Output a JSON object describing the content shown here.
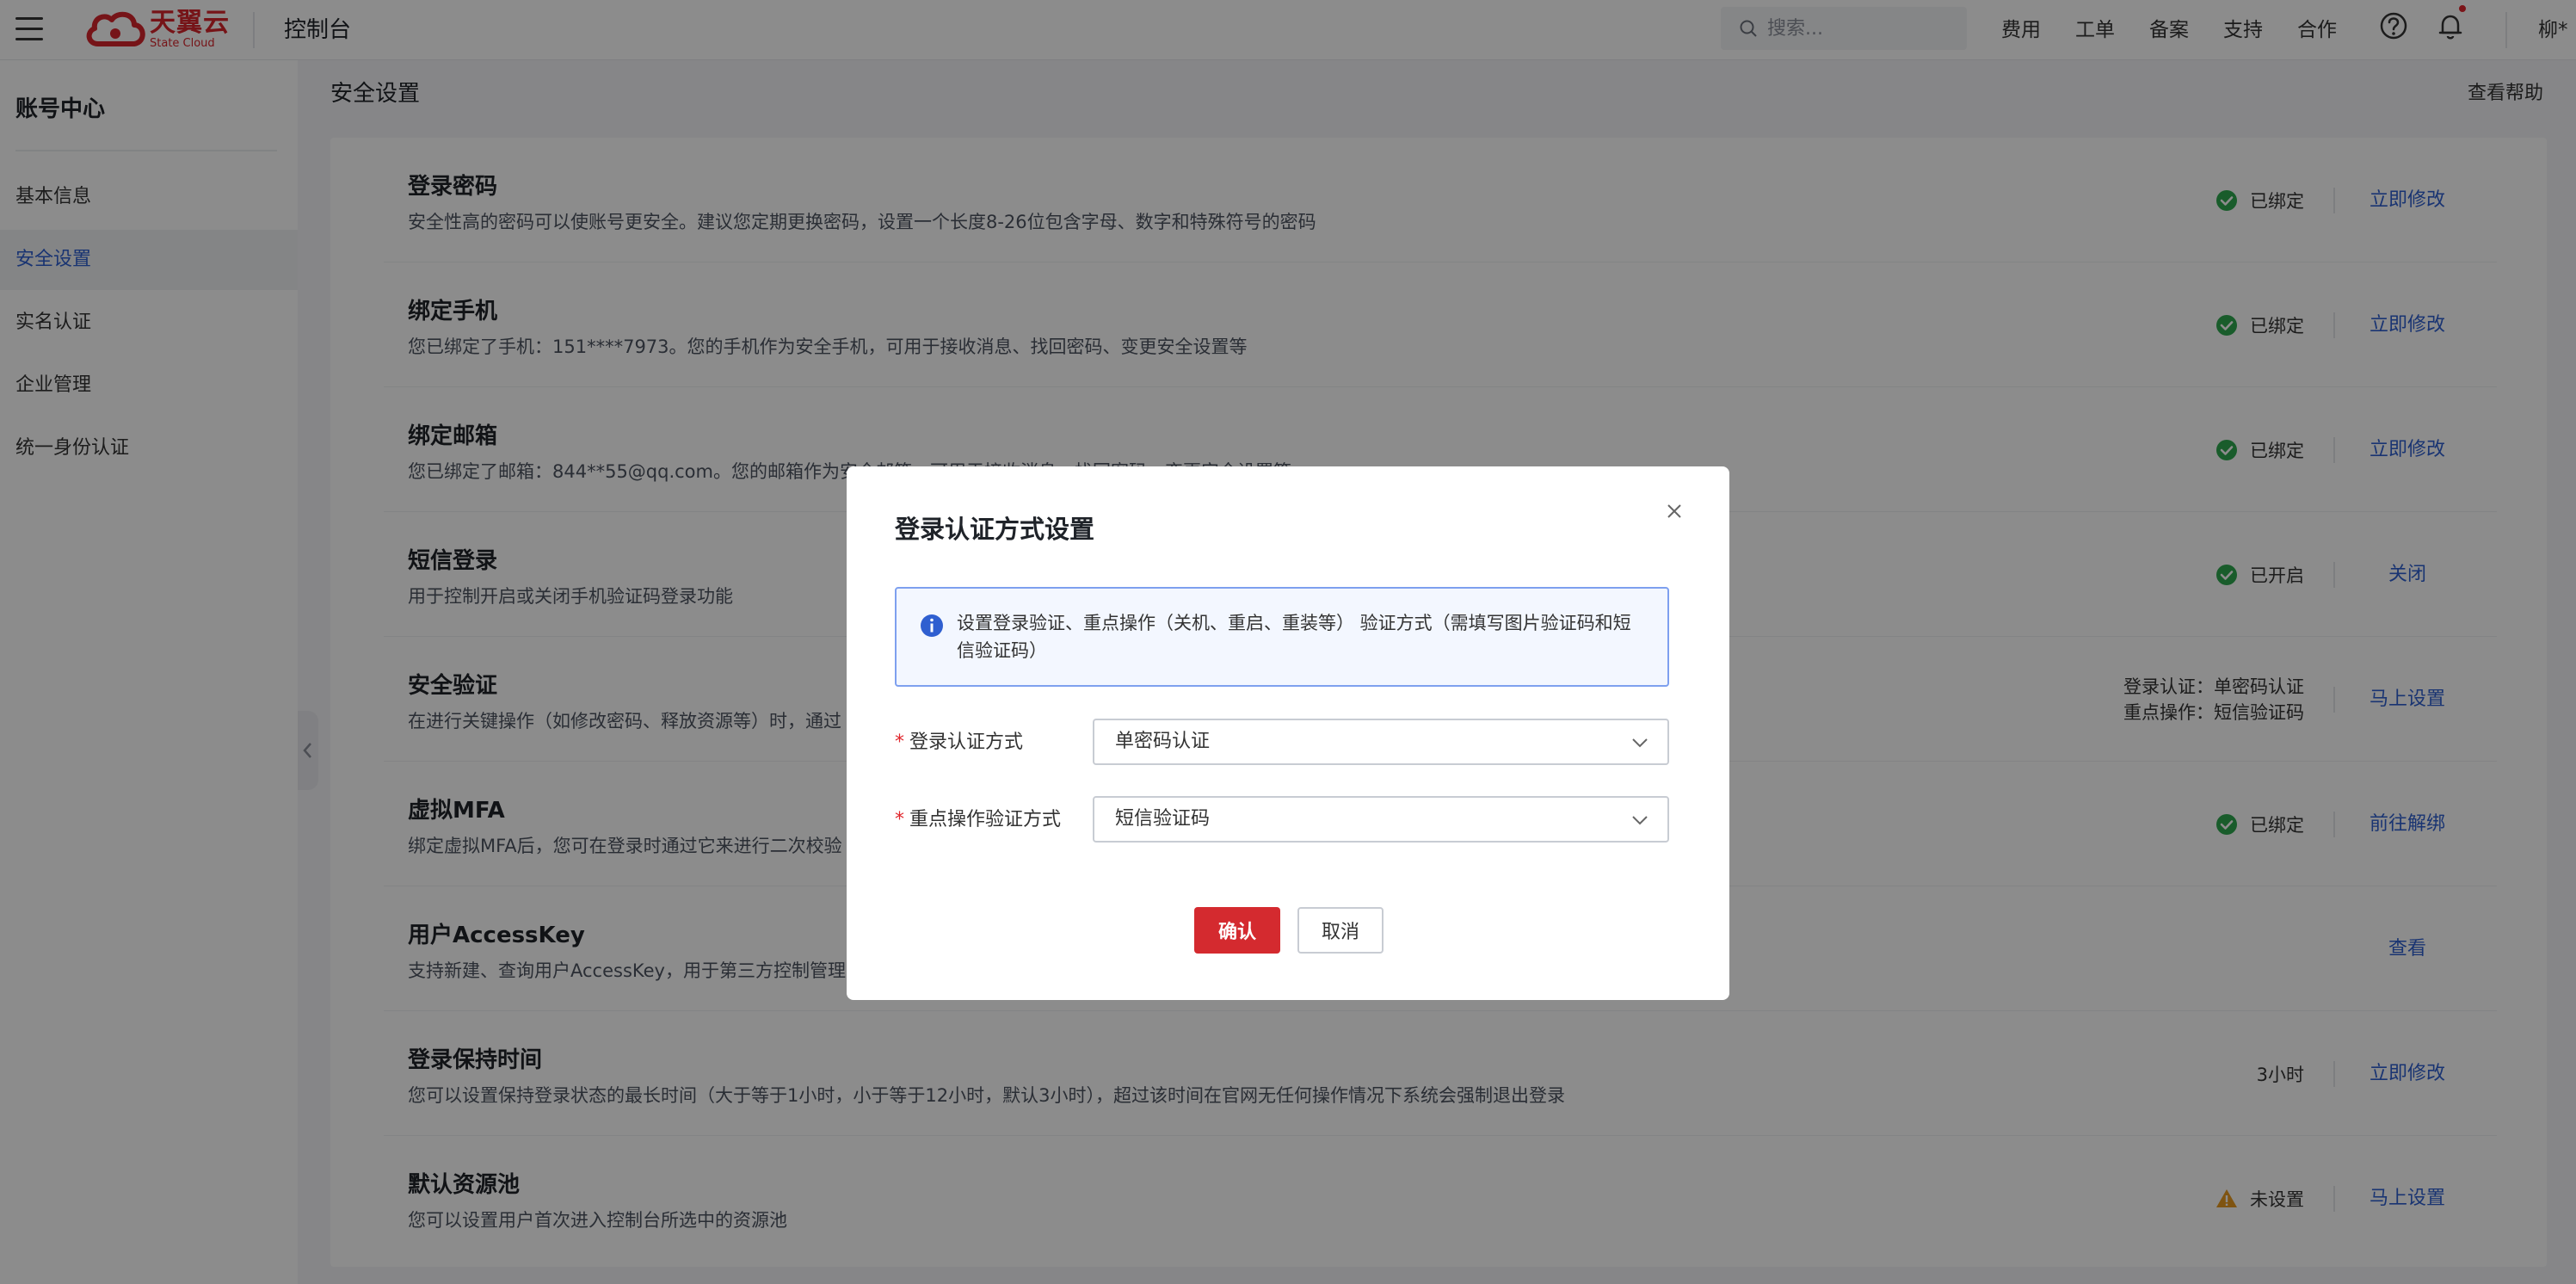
{
  "topbar": {
    "logo_cn": "天翼云",
    "logo_en": "State Cloud",
    "console_title": "控制台",
    "search_placeholder": "搜索...",
    "nav": [
      "费用",
      "工单",
      "备案",
      "支持",
      "合作"
    ],
    "user_name": "柳*",
    "brand_color": "#d8262c"
  },
  "sidebar": {
    "title": "账号中心",
    "items": [
      {
        "label": "基本信息",
        "active": false
      },
      {
        "label": "安全设置",
        "active": true
      },
      {
        "label": "实名认证",
        "active": false
      },
      {
        "label": "企业管理",
        "active": false
      },
      {
        "label": "统一身份认证",
        "active": false
      }
    ]
  },
  "main": {
    "title": "安全设置",
    "help_label": "查看帮助",
    "rows": [
      {
        "title": "登录密码",
        "desc": "安全性高的密码可以使账号更安全。建议您定期更换密码，设置一个长度8-26位包含字母、数字和特殊符号的密码",
        "status": "已绑定",
        "status_icon": "check-circle-icon",
        "action": "立即修改"
      },
      {
        "title": "绑定手机",
        "desc": "您已绑定了手机：151****7973。您的手机作为安全手机，可用于接收消息、找回密码、变更安全设置等",
        "status": "已绑定",
        "status_icon": "check-circle-icon",
        "action": "立即修改"
      },
      {
        "title": "绑定邮箱",
        "desc": "您已绑定了邮箱：844**55@qq.com。您的邮箱作为安全邮箱，可用于接收消息、找回密码、变更安全设置等",
        "status": "已绑定",
        "status_icon": "check-circle-icon",
        "action": "立即修改"
      },
      {
        "title": "短信登录",
        "desc": "用于控制开启或关闭手机验证码登录功能",
        "status": "已开启",
        "status_icon": "check-circle-icon",
        "action": "关闭"
      },
      {
        "title": "安全验证",
        "desc": "在进行关键操作（如修改密码、释放资源等）时，通过",
        "status_lines": [
          "登录认证：单密码认证",
          "重点操作：短信验证码"
        ],
        "action": "马上设置"
      },
      {
        "title": "虚拟MFA",
        "desc": "绑定虚拟MFA后，您可在登录时通过它来进行二次校验",
        "status": "已绑定",
        "status_icon": "check-circle-icon",
        "action": "前往解绑"
      },
      {
        "title": "用户AccessKey",
        "desc": "支持新建、查询用户AccessKey，用于第三方控制管理",
        "action": "查看"
      },
      {
        "title": "登录保持时间",
        "desc": "您可以设置保持登录状态的最长时间（大于等于1小时，小于等于12小时，默认3小时），超过该时间在官网无任何操作情况下系统会强制退出登录",
        "status": "3小时",
        "action": "立即修改"
      },
      {
        "title": "默认资源池",
        "desc": "您可以设置用户首次进入控制台所选中的资源池",
        "status": "未设置",
        "status_icon": "warning-icon",
        "action": "马上设置"
      }
    ]
  },
  "modal": {
    "title": "登录认证方式设置",
    "info": "设置登录验证、重点操作（关机、重启、重装等） 验证方式（需填写图片验证码和短信验证码）",
    "fields": [
      {
        "label": "登录认证方式",
        "value": "单密码认证"
      },
      {
        "label": "重点操作验证方式",
        "value": "短信验证码"
      }
    ],
    "confirm_label": "确认",
    "cancel_label": "取消"
  },
  "colors": {
    "link": "#2f5fd0",
    "success": "#2fa84f",
    "warning": "#e89a1f",
    "confirm_button": "#d42a2f"
  }
}
